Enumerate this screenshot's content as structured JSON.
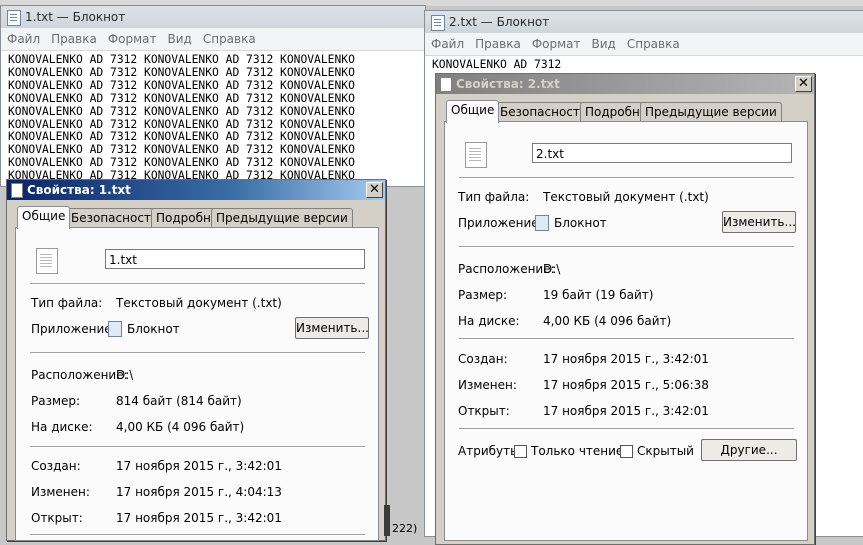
{
  "notepad1": {
    "title": "1.txt — Блокнот",
    "menu": [
      "Файл",
      "Правка",
      "Формат",
      "Вид",
      "Справка"
    ],
    "lines": [
      "KONOVALENKO AD 7312 KONOVALENKO AD 7312 KONOVALENKO",
      "KONOVALENKO AD 7312 KONOVALENKO AD 7312 KONOVALENKO",
      "KONOVALENKO AD 7312 KONOVALENKO AD 7312 KONOVALENKO",
      "KONOVALENKO AD 7312 KONOVALENKO AD 7312 KONOVALENKO",
      "KONOVALENKO AD 7312 KONOVALENKO AD 7312 KONOVALENKO",
      "KONOVALENKO AD 7312 KONOVALENKO AD 7312 KONOVALENKO",
      "KONOVALENKO AD 7312 KONOVALENKO AD 7312 KONOVALENKO",
      "KONOVALENKO AD 7312 KONOVALENKO AD 7312 KONOVALENKO",
      "KONOVALENKO AD 7312 KONOVALENKO AD 7312 KONOVALENKO",
      "KONOVALENKO AD 7312 KONOVALENKO AD 7312 KONOVALENKO"
    ]
  },
  "notepad2": {
    "title": "2.txt — Блокнот",
    "menu": [
      "Файл",
      "Правка",
      "Формат",
      "Вид",
      "Справка"
    ],
    "lines": [
      "KONOVALENKO AD 7312"
    ]
  },
  "props1": {
    "title": "Свойства: 1.txt",
    "close": "✕",
    "tabs": [
      "Общие",
      "Безопасность",
      "Подробно",
      "Предыдущие версии"
    ],
    "filename": "1.txt",
    "type_label": "Тип файла:",
    "type_value": "Текстовый документ (.txt)",
    "app_label": "Приложение:",
    "app_value": "Блокнот",
    "change_button": "Изменить...",
    "location_label": "Расположение:",
    "location_value": "D:\\",
    "size_label": "Размер:",
    "size_value": "814 байт (814 байт)",
    "disk_label": "На диске:",
    "disk_value": "4,00 КБ (4 096 байт)",
    "created_label": "Создан:",
    "created_value": "17 ноября 2015 г., 3:42:01",
    "modified_label": "Изменен:",
    "modified_value": "17 ноября 2015 г., 4:04:13",
    "opened_label": "Открыт:",
    "opened_value": "17 ноября 2015 г., 3:42:01"
  },
  "props2": {
    "title": "Свойства: 2.txt",
    "close": "✕",
    "tabs": [
      "Общие",
      "Безопасность",
      "Подробно",
      "Предыдущие версии"
    ],
    "filename": "2.txt",
    "type_label": "Тип файла:",
    "type_value": "Текстовый документ (.txt)",
    "app_label": "Приложение:",
    "app_value": "Блокнот",
    "change_button": "Изменить...",
    "location_label": "Расположение:",
    "location_value": "D:\\",
    "size_label": "Размер:",
    "size_value": "19 байт (19 байт)",
    "disk_label": "На диске:",
    "disk_value": "4,00 КБ (4 096 байт)",
    "created_label": "Создан:",
    "created_value": "17 ноября 2015 г., 3:42:01",
    "modified_label": "Изменен:",
    "modified_value": "17 ноября 2015 г., 5:06:38",
    "opened_label": "Открыт:",
    "opened_value": "17 ноября 2015 г., 3:42:01",
    "attributes_label": "Атрибуты:",
    "readonly_label": "Только чтение",
    "hidden_label": "Скрытый",
    "other_button": "Другие..."
  },
  "background": {
    "status_fragment": "222)"
  }
}
